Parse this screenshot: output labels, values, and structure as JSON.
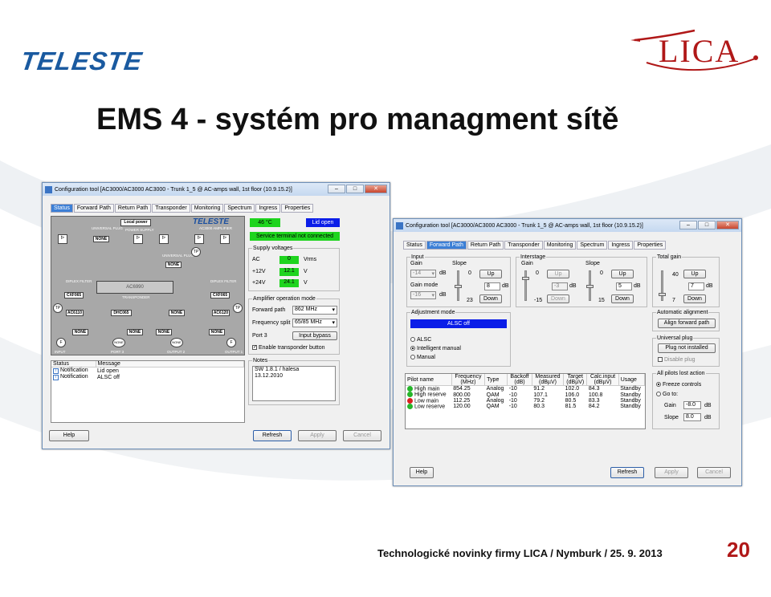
{
  "slide": {
    "title": "EMS 4 - systém pro managment sítě",
    "teleste_logo": "TELESTE",
    "lica_logo": "LICA",
    "footer": "Technologické novinky firmy LICA / Nymburk / 25. 9. 2013",
    "page_number": "20"
  },
  "colors": {
    "teleste_blue": "#1a5aa0",
    "lica_red": "#b01818",
    "accent_tab": "#3c7fd6",
    "ok_green": "#1ed41e",
    "lid_blue": "#0b1ee8"
  },
  "win1": {
    "title": "Configuration tool [AC3000/AC3000 AC3000 - Trunk 1_5 @ AC-amps wall, 1st floor (10.9.15.2)]",
    "tabs": [
      "Status",
      "Forward Path",
      "Return Path",
      "Transponder",
      "Monitoring",
      "Spectrum",
      "Ingress",
      "Properties"
    ],
    "active_tab": "Status",
    "diagram": {
      "local_power": "Local power",
      "logo": "TELESTE",
      "amplifier": "AC3000 AMPLIFIER",
      "universal_plug": "UNIVERSAL PLUG",
      "power_supply": "POWER SUPPLY",
      "none": "NONE",
      "transponder_box": "AC6990",
      "transponder": "TRANSPONDER",
      "diplex_left": "DIPLEX FILTER",
      "diplex_right": "DIPLEX FILTER",
      "cxf_left": "CXF065",
      "cxf_right": "CXF065",
      "ac_left": "AC6110",
      "ac_right": "AC6120",
      "dp_mid": "DHC065",
      "input": "INPUT",
      "port3": "PORT 3",
      "output2": "OUTPUT 2",
      "output1": "OUTPUT 1",
      "f": "F",
      "tp": "TP"
    },
    "temp": "46 °C",
    "lid": "Lid open",
    "service": "Service terminal not connected",
    "supply_group": "Supply voltages",
    "supply": [
      {
        "label": "AC",
        "value": "0",
        "unit": "Vrms"
      },
      {
        "label": "+12V",
        "value": "12.1",
        "unit": "V"
      },
      {
        "label": "+24V",
        "value": "24.1",
        "unit": "V"
      }
    ],
    "amp_group": "Amplifier operation mode",
    "forward_path_label": "Forward path",
    "forward_path_value": "862 MHz",
    "freq_split_label": "Frequency split",
    "freq_split_value": "65/85 MHz",
    "port3_label": "Port 3",
    "port3_value": "Input bypass",
    "enable_transponder": "Enable transponder button",
    "notes_group": "Notes",
    "notes": [
      "SW 1.8.1 / halesa",
      "13.12.2010"
    ],
    "status_headers": [
      "Status",
      "Message"
    ],
    "status_rows": [
      {
        "status": "Notification",
        "message": "Lid open"
      },
      {
        "status": "Notification",
        "message": "ALSC off"
      }
    ],
    "buttons": {
      "help": "Help",
      "refresh": "Refresh",
      "apply": "Apply",
      "cancel": "Cancel"
    }
  },
  "win2": {
    "title": "Configuration tool [AC3000/AC3000 AC3000 - Trunk 1_5 @ AC-amps wall, 1st floor (10.9.15.2)]",
    "tabs": [
      "Status",
      "Forward Path",
      "Return Path",
      "Transponder",
      "Monitoring",
      "Spectrum",
      "Ingress",
      "Properties"
    ],
    "active_tab": "Forward Path",
    "input_group": "Input",
    "gain_label": "Gain",
    "gain_value": "-14",
    "db": "dB",
    "gain_mode_label": "Gain mode",
    "gain_mode_value": "-16",
    "slope_label": "Slope",
    "slope_top": "0",
    "slope_bottom": "23",
    "slope_value": "8",
    "up": "Up",
    "down": "Down",
    "interstage_group": "Interstage",
    "is_gain_label": "Gain",
    "is_gain_top": "0",
    "is_gain_bottom": "-15",
    "is_gain_value": "-3",
    "is_slope_label": "Slope",
    "is_slope_top": "0",
    "is_slope_bottom": "15",
    "is_slope_value": "5",
    "total_gain_group": "Total gain",
    "tg_top": "40",
    "tg_bottom": "7",
    "tg_value": "7",
    "adj_group": "Adjustment mode",
    "alsc_status": "ALSC off",
    "adj_options": [
      "ALSC",
      "Intelligent manual",
      "Manual"
    ],
    "adj_selected": "Intelligent manual",
    "auto_align_group": "Automatic alignment",
    "align_btn": "Align forward path",
    "uplug_group": "Universal plug",
    "plug_btn": "Plug not installed",
    "disable_plug": "Disable plug",
    "pilots_lost_group": "All pilots lost action",
    "freeze": "Freeze controls",
    "goto": "Go to:",
    "pl_gain_label": "Gain",
    "pl_gain_value": "-8.0",
    "pl_slope_label": "Slope",
    "pl_slope_value": "8.0",
    "pilot_headers": [
      "Pilot name",
      "Frequency\n(MHz)",
      "Type",
      "Backoff\n(dB)",
      "Measured\n(dBµV)",
      "Target\n(dBµV)",
      "Calc.input\n(dBµV)",
      "Usage"
    ],
    "pilot_rows": [
      {
        "ok": true,
        "name": "High main",
        "freq": "854.25",
        "type": "Analog",
        "backoff": "-10",
        "measured": "91.2",
        "target": "102.0",
        "calc": "84.3",
        "usage": "Standby"
      },
      {
        "ok": true,
        "name": "High reserve",
        "freq": "800.00",
        "type": "QAM",
        "backoff": "-10",
        "measured": "107.1",
        "target": "106.0",
        "calc": "100.8",
        "usage": "Standby"
      },
      {
        "ok": false,
        "name": "Low main",
        "freq": "112.25",
        "type": "Analog",
        "backoff": "-10",
        "measured": "79.2",
        "target": "80.5",
        "calc": "83.3",
        "usage": "Standby"
      },
      {
        "ok": true,
        "name": "Low reserve",
        "freq": "120.00",
        "type": "QAM",
        "backoff": "-10",
        "measured": "80.3",
        "target": "81.5",
        "calc": "84.2",
        "usage": "Standby"
      }
    ],
    "buttons": {
      "help": "Help",
      "refresh": "Refresh",
      "apply": "Apply",
      "cancel": "Cancel"
    }
  }
}
